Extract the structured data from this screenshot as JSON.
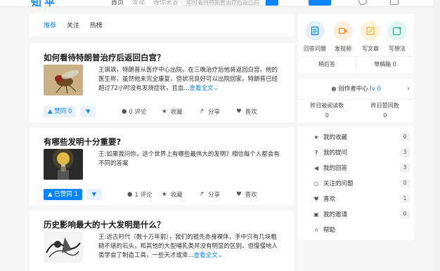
{
  "topbar": {
    "logo": "知乎",
    "nav": [
      "首页",
      "发现",
      "等你来答"
    ],
    "search_placeholder": "如何看待特朗普治疗后返回白宫?",
    "ask_label": "提问"
  },
  "feed": {
    "tabs": [
      {
        "label": "推荐",
        "active": true
      },
      {
        "label": "关注",
        "active": false
      },
      {
        "label": "热榜",
        "active": false
      }
    ],
    "cards": [
      {
        "title": "如何看待特朗普治疗后返回白宫？",
        "excerpt": "王飒飒，特朗普从医疗中心出院，在三晚治疗后他将返回白宫。他的医生称，虽然他未完全康复，但状况良好可以出院回家。特朗普已经超过72小时没有发烧症状，且血...",
        "more": "查看全文",
        "vote_label": "赞同 0",
        "vote_active": false,
        "comments": "0 评论",
        "collect": "收藏",
        "share": "分享",
        "like": "喜欢"
      },
      {
        "title": "有哪些发明十分重要?",
        "excerpt": "王:如果我问你，这个世界上有哪些最伟大的发明？相信每个人都会有不同的答案",
        "more": "",
        "vote_label": "已赞同 1",
        "vote_active": true,
        "comments": "1 评论",
        "collect": "收藏",
        "share": "分享",
        "like": "喜欢"
      },
      {
        "title": "历史影响最大的十大发明是什么？",
        "excerpt": "王:远古时代（数十万年前），我们的祖先赤身裸体，手中只有几块粗糙不堪的石头，和其他的大型哺乳类并没有明显的区别。但慢慢地人类学会了制造工具，一些天才或幸...",
        "more": "查看全文"
      }
    ]
  },
  "sidebar": {
    "quick": [
      {
        "label": "回答问题",
        "color": "#e3f0fb",
        "fg": "#0a84ff"
      },
      {
        "label": "发视频",
        "color": "#fdeee2",
        "fg": "#f08a24"
      },
      {
        "label": "写文章",
        "color": "#fdf3dc",
        "fg": "#f0b429"
      },
      {
        "label": "写想法",
        "color": "#e2f5f0",
        "fg": "#1bb394"
      }
    ],
    "draft_left": "稍后答",
    "draft_right": "草稿箱 0",
    "creator_title": "创作者中心",
    "creator_level": "lv 0",
    "stats": [
      {
        "label": "昨日被阅读数",
        "value": "0"
      },
      {
        "label": "昨日赞同数",
        "value": "0"
      }
    ],
    "menu": [
      {
        "icon": "star-icon",
        "glyph": "★",
        "label": "我的收藏",
        "count": "0"
      },
      {
        "icon": "question-icon",
        "glyph": "?",
        "label": "我的提问",
        "count": "3"
      },
      {
        "icon": "megaphone-icon",
        "glyph": "✎",
        "label": "我的回答",
        "count": "3"
      },
      {
        "icon": "search-icon",
        "glyph": "⚲",
        "label": "关注的问题",
        "count": "0"
      },
      {
        "icon": "heart-icon",
        "glyph": "♥",
        "label": "喜欢",
        "count": "1"
      },
      {
        "icon": "invite-icon",
        "glyph": "✉",
        "label": "我的邀请",
        "count": "0"
      },
      {
        "icon": "headset-icon",
        "glyph": "☊",
        "label": "帮助",
        "count": ""
      }
    ]
  },
  "colors": {
    "accent": "#0a84ff",
    "bg": "#f6f6f6"
  }
}
